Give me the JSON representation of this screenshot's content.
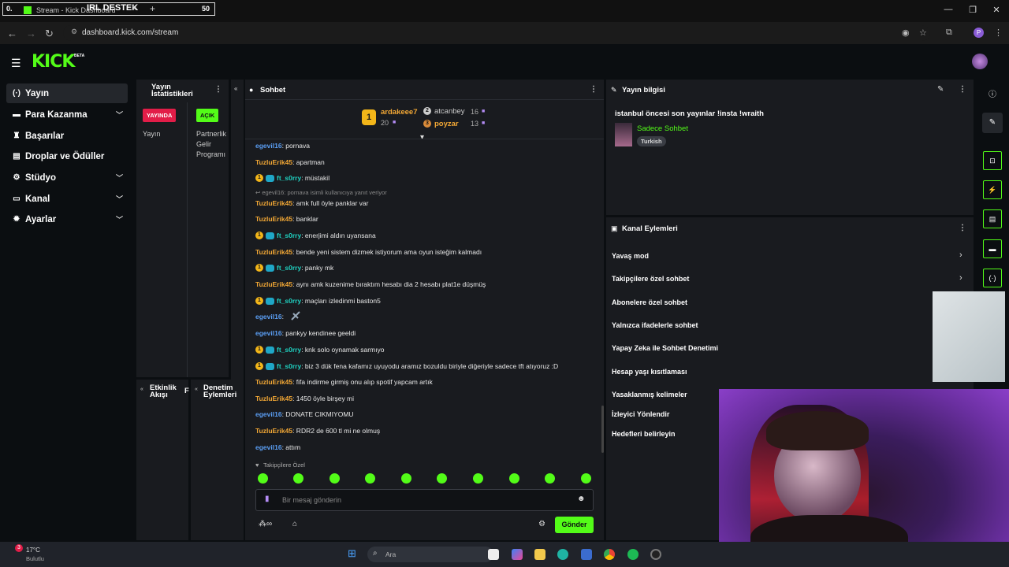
{
  "browser": {
    "overlay_left": "0.",
    "overlay_title": "IRL DESTEK",
    "overlay_num": "50",
    "tab_title": "Stream - Kick Dashboard",
    "tab_close": "×",
    "new_tab": "+",
    "url": "dashboard.kick.com/stream",
    "profile": "P"
  },
  "kick": {
    "logo": "KICK",
    "beta": "BETA"
  },
  "sidebar": {
    "items": [
      {
        "label": "Yayın",
        "icon": "broadcast-icon"
      },
      {
        "label": "Para Kazanma",
        "icon": "money-icon"
      },
      {
        "label": "Başarılar",
        "icon": "trophy-icon"
      },
      {
        "label": "Droplar ve Ödüller",
        "icon": "gift-icon"
      },
      {
        "label": "Stüdyo",
        "icon": "studio-icon"
      },
      {
        "label": "Kanal",
        "icon": "channel-icon"
      },
      {
        "label": "Ayarlar",
        "icon": "gear-icon"
      }
    ]
  },
  "stats": {
    "title_line1": "Yayın",
    "title_line2": "İstatistikleri",
    "live_badge": "YAYINDA",
    "open_badge": "AÇIK",
    "col1": "Yayın",
    "col2_l1": "Partnerlik",
    "col2_l2": "Gelir",
    "col2_l3": "Programı"
  },
  "activity": {
    "title_l1": "Etkinlik",
    "title_l2": "Akışı",
    "extra": "F"
  },
  "moderation": {
    "title_l1": "Denetim",
    "title_l2": "Eylemleri"
  },
  "chat": {
    "title": "Sohbet",
    "leaders": [
      {
        "rank": "1",
        "name": "ardakeee7",
        "count": "20"
      },
      {
        "rank": "2",
        "name": "atcanbey",
        "count": "16"
      },
      {
        "rank": "3",
        "name": "poyzar",
        "count": "13"
      }
    ],
    "messages": [
      {
        "user": "egevil16",
        "cls": "u-ege",
        "text": ": pornava",
        "badges": 0
      },
      {
        "user": "TuzluErik45",
        "cls": "u-tuz",
        "text": ": apartman",
        "badges": 0
      },
      {
        "user": "ft_s0rry",
        "cls": "u-ft",
        "text": ": müstakil",
        "badges": 2
      },
      {
        "user": "TuzluErik45",
        "cls": "u-tuz",
        "text": ": amk full öyle panklar var",
        "badges": 0
      },
      {
        "user": "TuzluErik45",
        "cls": "u-tuz",
        "text": ": banklar",
        "badges": 0
      },
      {
        "user": "ft_s0rry",
        "cls": "u-ft",
        "text": ": enerjimi aldın uyansana",
        "badges": 2
      },
      {
        "user": "TuzluErik45",
        "cls": "u-tuz",
        "text": ": bende yeni sistem dizmek istiyorum ama oyun isteğim kalmadı",
        "badges": 0
      },
      {
        "user": "ft_s0rry",
        "cls": "u-ft",
        "text": ": panky mk",
        "badges": 2
      },
      {
        "user": "TuzluErik45",
        "cls": "u-tuz",
        "text": ": aynı amk kuzenime bıraktım hesabı dia 2 hesabı plat1e düşmüş",
        "badges": 0
      },
      {
        "user": "ft_s0rry",
        "cls": "u-ft",
        "text": ": maçları izledinmi baston5",
        "badges": 2
      },
      {
        "user": "egevil16",
        "cls": "u-ege",
        "text": ":",
        "badges": 0
      },
      {
        "user": "egevil16",
        "cls": "u-ege",
        "text": ": pankyy kendinee geeldi",
        "badges": 0
      },
      {
        "user": "ft_s0rry",
        "cls": "u-ft",
        "text": ": knk solo oynamak sarmıyo",
        "badges": 2
      },
      {
        "user": "ft_s0rry",
        "cls": "u-ft",
        "text": ": biz 3 dük fena kafamız uyuyodu aramız bozuldu biriyle diğeriyle sadece tft atıyoruz :D",
        "badges": 2
      },
      {
        "user": "TuzluErik45",
        "cls": "u-tuz",
        "text": ": fifa indirme girmiş onu alıp spotif yapcam artık",
        "badges": 0
      },
      {
        "user": "TuzluErik45",
        "cls": "u-tuz",
        "text": ": 1450 öyle birşey mi",
        "badges": 0
      },
      {
        "user": "egevil16",
        "cls": "u-ege",
        "text": ": DONATE CIKMIYOMU",
        "badges": 0
      },
      {
        "user": "TuzluErik45",
        "cls": "u-tuz",
        "text": ": RDR2 de 600 tl mi ne olmuş",
        "badges": 0
      },
      {
        "user": "egevil16",
        "cls": "u-ege",
        "text": ": attım",
        "badges": 0
      }
    ],
    "reply_text": "egevil16: pornava isimli kullanıcıya yanıt veriyor",
    "followers_only": "Takipçilere Özel",
    "input_placeholder": "Bir mesaj gönderin",
    "send_label": "Gönder"
  },
  "stream_info": {
    "title": "Yayın bilgisi",
    "stream_title": "istanbul öncesi son yayınlar !insta !wraith",
    "category": "Sadece Sohbet",
    "tag": "Turkish"
  },
  "channel_actions": {
    "title": "Kanal Eylemleri",
    "items": [
      "Yavaş mod",
      "Takipçilere özel sohbet",
      "Abonelere özel sohbet",
      "Yalnızca ifadelerle sohbet",
      "Yapay Zeka ile Sohbet Denetimi",
      "Hesap yaşı kısıtlaması",
      "Yasaklanmış kelimeler",
      "İzleyici Yönlendir",
      "Hedefleri belirleyin"
    ]
  },
  "taskbar": {
    "temp": "17°C",
    "weather": "Bulutlu",
    "notif": "3",
    "search": "Ara"
  },
  "colors": {
    "accent": "#53fc18",
    "live": "#e21d48"
  }
}
